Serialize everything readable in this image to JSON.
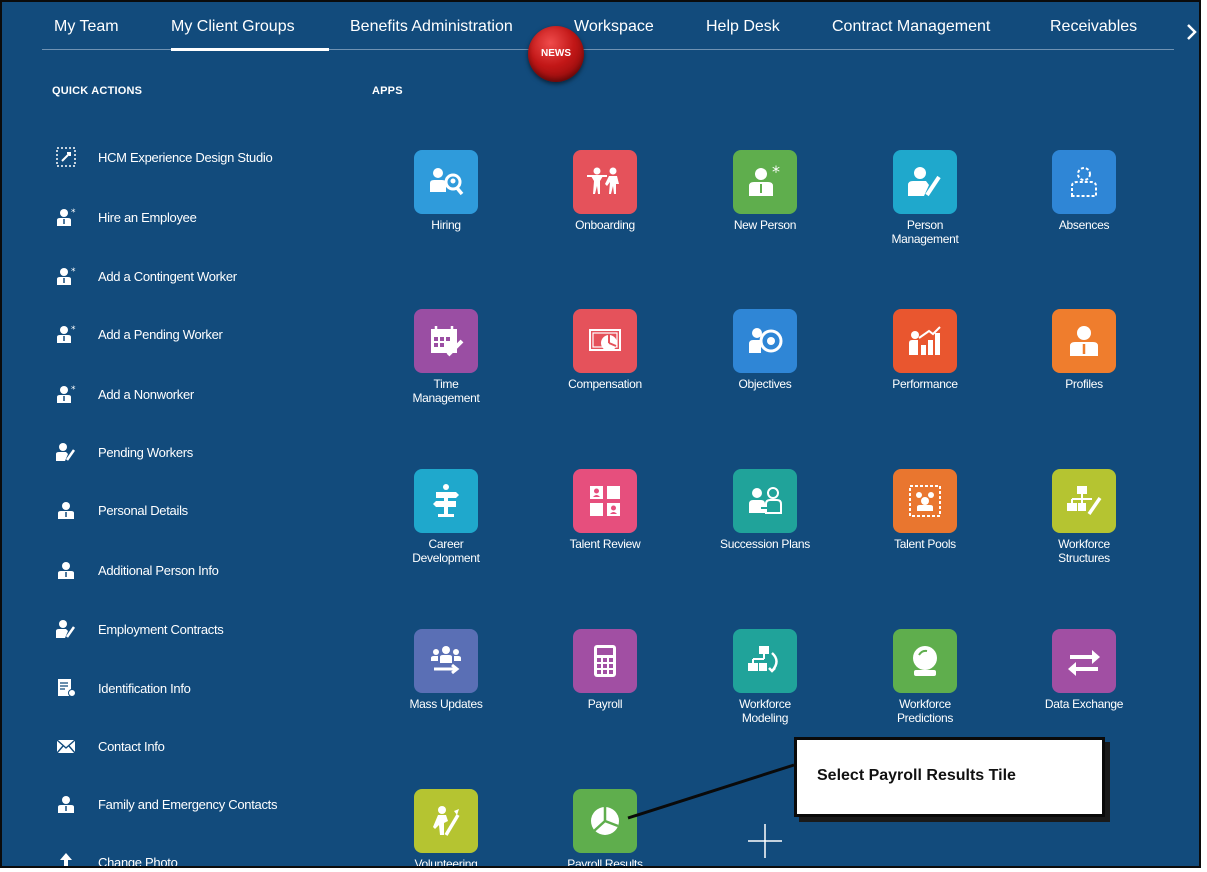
{
  "top_nav": {
    "items": [
      {
        "label": "My Team",
        "active": false
      },
      {
        "label": "My Client Groups",
        "active": true
      },
      {
        "label": "Benefits Administration",
        "active": false
      },
      {
        "label": "Workspace",
        "active": false
      },
      {
        "label": "Help Desk",
        "active": false
      },
      {
        "label": "Contract Management",
        "active": false
      },
      {
        "label": "Receivables",
        "active": false
      }
    ],
    "more_icon": "chevron-right-icon",
    "news_badge": "NEWS"
  },
  "quick_actions": {
    "heading": "QUICK ACTIONS",
    "items": [
      {
        "label": "HCM Experience Design Studio",
        "icon": "design-studio-icon"
      },
      {
        "label": "Hire an Employee",
        "icon": "new-person-icon"
      },
      {
        "label": "Add a Contingent Worker",
        "icon": "new-person-icon"
      },
      {
        "label": "Add a Pending Worker",
        "icon": "new-person-icon"
      },
      {
        "label": "Add a Nonworker",
        "icon": "new-person-icon"
      },
      {
        "label": "Pending Workers",
        "icon": "person-edit-icon"
      },
      {
        "label": "Personal Details",
        "icon": "person-icon"
      },
      {
        "label": "Additional Person Info",
        "icon": "person-icon"
      },
      {
        "label": "Employment Contracts",
        "icon": "person-edit-icon"
      },
      {
        "label": "Identification Info",
        "icon": "id-document-icon"
      },
      {
        "label": "Contact Info",
        "icon": "envelope-icon"
      },
      {
        "label": "Family and Emergency Contacts",
        "icon": "person-icon"
      },
      {
        "label": "Change Photo",
        "icon": "upload-icon"
      }
    ]
  },
  "apps": {
    "heading": "APPS",
    "items": [
      {
        "label": "Hiring",
        "color": "#2f9bdb",
        "icon": "hiring-icon"
      },
      {
        "label": "Onboarding",
        "color": "#e5525b",
        "icon": "onboarding-icon"
      },
      {
        "label": "New Person",
        "color": "#5fae4d",
        "icon": "new-person-icon"
      },
      {
        "label": "Person\nManagement",
        "color": "#1fa8cc",
        "icon": "person-edit-icon"
      },
      {
        "label": "Absences",
        "color": "#2f86d6",
        "icon": "absence-icon"
      },
      {
        "label": "Time\nManagement",
        "color": "#9a4ea3",
        "icon": "calendar-icon"
      },
      {
        "label": "Compensation",
        "color": "#e5525b",
        "icon": "compensation-icon"
      },
      {
        "label": "Objectives",
        "color": "#2f86d6",
        "icon": "objectives-icon"
      },
      {
        "label": "Performance",
        "color": "#e9562f",
        "icon": "performance-icon"
      },
      {
        "label": "Profiles",
        "color": "#ef7d2d",
        "icon": "profile-icon"
      },
      {
        "label": "Career\nDevelopment",
        "color": "#1fa8cc",
        "icon": "signpost-icon"
      },
      {
        "label": "Talent Review",
        "color": "#e64f7d",
        "icon": "talent-review-icon"
      },
      {
        "label": "Succession Plans",
        "color": "#20a39a",
        "icon": "succession-icon"
      },
      {
        "label": "Talent Pools",
        "color": "#e9762f",
        "icon": "talent-pool-icon"
      },
      {
        "label": "Workforce\nStructures",
        "color": "#b5c431",
        "icon": "structures-icon"
      },
      {
        "label": "Mass Updates",
        "color": "#5a6fb5",
        "icon": "mass-update-icon"
      },
      {
        "label": "Payroll",
        "color": "#a14fa3",
        "icon": "calculator-icon"
      },
      {
        "label": "Workforce\nModeling",
        "color": "#20a39a",
        "icon": "modeling-icon"
      },
      {
        "label": "Workforce\nPredictions",
        "color": "#5fae4d",
        "icon": "crystal-ball-icon"
      },
      {
        "label": "Data Exchange",
        "color": "#a14fa3",
        "icon": "exchange-icon"
      },
      {
        "label": "Volunteering",
        "color": "#b5c431",
        "icon": "volunteer-icon"
      },
      {
        "label": "Payroll Results",
        "color": "#5fae4d",
        "icon": "pie-chart-icon"
      }
    ],
    "add_icon": "plus-icon"
  },
  "callout": {
    "text": "Select Payroll Results Tile"
  },
  "colors": {
    "background": "#124b7c",
    "text": "#ffffff"
  }
}
